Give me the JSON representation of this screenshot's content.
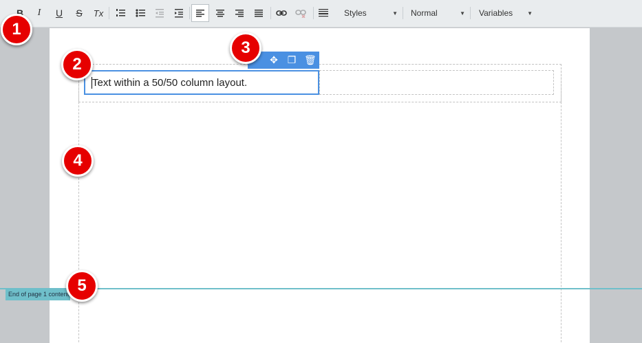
{
  "toolbar": {
    "buttons": [
      {
        "label": "B",
        "name": "bold-button"
      },
      {
        "label": "I",
        "name": "italic-button"
      },
      {
        "label": "U",
        "name": "underline-button"
      },
      {
        "label": "S",
        "name": "strikethrough-button"
      },
      {
        "label": "Tx",
        "name": "remove-format-button"
      }
    ],
    "styles_label": "Styles",
    "format_label": "Normal",
    "variables_label": "Variables"
  },
  "editor": {
    "column_text": "Text within a 50/50 column layout."
  },
  "page_break": {
    "label": "End of page 1 content"
  },
  "markers": [
    "1",
    "2",
    "3",
    "4",
    "5"
  ],
  "colors": {
    "accent": "#4a90e2",
    "marker": "#e60000",
    "page_break": "#6fbfca"
  }
}
